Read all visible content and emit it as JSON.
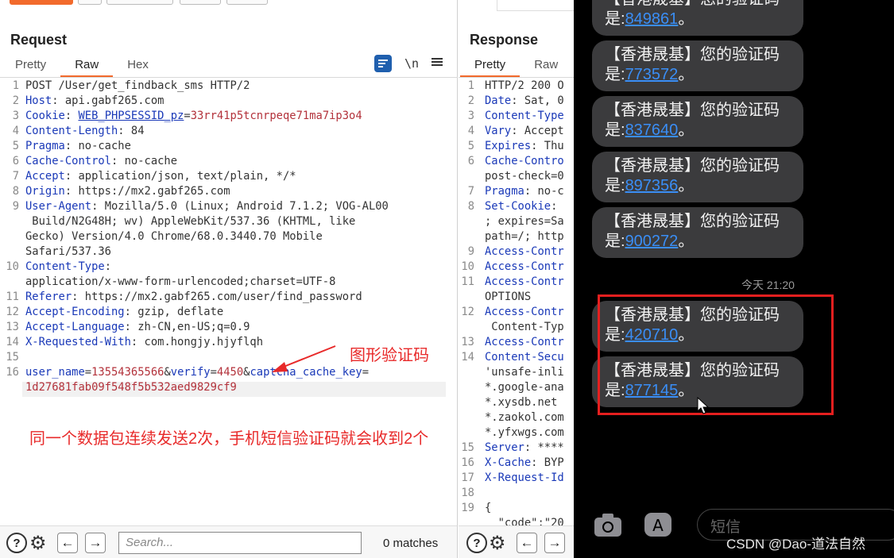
{
  "request": {
    "title": "Request",
    "tabs": [
      "Pretty",
      "Raw",
      "Hex"
    ],
    "active_tab": "Raw",
    "tool_newline": "\\n",
    "lines": [
      {
        "n": "1",
        "parts": [
          [
            "v",
            "POST /User/get_findback_sms HTTP/2"
          ]
        ]
      },
      {
        "n": "2",
        "parts": [
          [
            "k",
            "Host"
          ],
          [
            "v",
            ": api.gabf265.com"
          ]
        ]
      },
      {
        "n": "3",
        "parts": [
          [
            "k",
            "Cookie"
          ],
          [
            "v",
            ": "
          ],
          [
            "u",
            "WEB_PHPSESSID_pz"
          ],
          [
            "v",
            "="
          ],
          [
            "rv",
            "33rr41p5tcnrpeqe71ma7ip3o4"
          ]
        ]
      },
      {
        "n": "4",
        "parts": [
          [
            "k",
            "Content-Length"
          ],
          [
            "v",
            ": 84"
          ]
        ]
      },
      {
        "n": "5",
        "parts": [
          [
            "k",
            "Pragma"
          ],
          [
            "v",
            ": no-cache"
          ]
        ]
      },
      {
        "n": "6",
        "parts": [
          [
            "k",
            "Cache-Control"
          ],
          [
            "v",
            ": no-cache"
          ]
        ]
      },
      {
        "n": "7",
        "parts": [
          [
            "k",
            "Accept"
          ],
          [
            "v",
            ": application/json, text/plain, */*"
          ]
        ]
      },
      {
        "n": "8",
        "parts": [
          [
            "k",
            "Origin"
          ],
          [
            "v",
            ": https://mx2.gabf265.com"
          ]
        ]
      },
      {
        "n": "9",
        "parts": [
          [
            "k",
            "User-Agent"
          ],
          [
            "v",
            ": Mozilla/5.0 (Linux; Android 7.1.2; VOG-AL00"
          ]
        ]
      },
      {
        "n": "",
        "parts": [
          [
            "v",
            " Build/N2G48H; wv) AppleWebKit/537.36 (KHTML, like"
          ]
        ]
      },
      {
        "n": "",
        "parts": [
          [
            "v",
            "Gecko) Version/4.0 Chrome/68.0.3440.70 Mobile"
          ]
        ]
      },
      {
        "n": "",
        "parts": [
          [
            "v",
            "Safari/537.36"
          ]
        ]
      },
      {
        "n": "10",
        "parts": [
          [
            "k",
            "Content-Type"
          ],
          [
            "v",
            ":"
          ]
        ]
      },
      {
        "n": "",
        "parts": [
          [
            "v",
            "application/x-www-form-urlencoded;charset=UTF-8"
          ]
        ]
      },
      {
        "n": "11",
        "parts": [
          [
            "k",
            "Referer"
          ],
          [
            "v",
            ": https://mx2.gabf265.com/user/find_password"
          ]
        ]
      },
      {
        "n": "12",
        "parts": [
          [
            "k",
            "Accept-Encoding"
          ],
          [
            "v",
            ": gzip, deflate"
          ]
        ]
      },
      {
        "n": "13",
        "parts": [
          [
            "k",
            "Accept-Language"
          ],
          [
            "v",
            ": zh-CN,en-US;q=0.9"
          ]
        ]
      },
      {
        "n": "14",
        "parts": [
          [
            "k",
            "X-Requested-With"
          ],
          [
            "v",
            ": com.hongjy.hjyflqh"
          ]
        ]
      },
      {
        "n": "15",
        "parts": [
          [
            "v",
            ""
          ]
        ]
      },
      {
        "n": "16",
        "parts": [
          [
            "k",
            "user_name"
          ],
          [
            "v",
            "="
          ],
          [
            "rv",
            "13554365566"
          ],
          [
            "v",
            "&"
          ],
          [
            "k",
            "verify"
          ],
          [
            "v",
            "="
          ],
          [
            "rv",
            "4450"
          ],
          [
            "v",
            "&"
          ],
          [
            "k",
            "captcha_cache_key"
          ],
          [
            "v",
            "="
          ]
        ]
      },
      {
        "n": "",
        "parts": [
          [
            "rv",
            "1d27681fab09f548f5b532aed9829cf9"
          ]
        ]
      }
    ],
    "annotation_captcha": "图形验证码",
    "annotation_note": "同一个数据包连续发送2次，手机短信验证码就会收到2个",
    "search_placeholder": "Search...",
    "matches": "0 matches"
  },
  "response": {
    "title": "Response",
    "tabs": [
      "Pretty",
      "Raw"
    ],
    "active_tab": "Pretty",
    "lines": [
      {
        "n": "1",
        "parts": [
          [
            "v",
            "HTTP/2 200 O"
          ]
        ]
      },
      {
        "n": "2",
        "parts": [
          [
            "k",
            "Date"
          ],
          [
            "v",
            ": Sat, 0"
          ]
        ]
      },
      {
        "n": "3",
        "parts": [
          [
            "k",
            "Content-Type"
          ]
        ]
      },
      {
        "n": "4",
        "parts": [
          [
            "k",
            "Vary"
          ],
          [
            "v",
            ": Accept"
          ]
        ]
      },
      {
        "n": "5",
        "parts": [
          [
            "k",
            "Expires"
          ],
          [
            "v",
            ": Thu"
          ]
        ]
      },
      {
        "n": "6",
        "parts": [
          [
            "k",
            "Cache-Contro"
          ]
        ]
      },
      {
        "n": "",
        "parts": [
          [
            "v",
            "post-check=0"
          ]
        ]
      },
      {
        "n": "7",
        "parts": [
          [
            "k",
            "Pragma"
          ],
          [
            "v",
            ": no-c"
          ]
        ]
      },
      {
        "n": "8",
        "parts": [
          [
            "k",
            "Set-Cookie"
          ],
          [
            "v",
            ":"
          ]
        ]
      },
      {
        "n": "",
        "parts": [
          [
            "v",
            "; expires=Sa"
          ]
        ]
      },
      {
        "n": "",
        "parts": [
          [
            "v",
            "path=/; http"
          ]
        ]
      },
      {
        "n": "9",
        "parts": [
          [
            "k",
            "Access-Contr"
          ]
        ]
      },
      {
        "n": "10",
        "parts": [
          [
            "k",
            "Access-Contr"
          ]
        ]
      },
      {
        "n": "11",
        "parts": [
          [
            "k",
            "Access-Contr"
          ]
        ]
      },
      {
        "n": "",
        "parts": [
          [
            "v",
            "OPTIONS"
          ]
        ]
      },
      {
        "n": "12",
        "parts": [
          [
            "k",
            "Access-Contr"
          ]
        ]
      },
      {
        "n": "",
        "parts": [
          [
            "v",
            " Content-Typ"
          ]
        ]
      },
      {
        "n": "13",
        "parts": [
          [
            "k",
            "Access-Contr"
          ]
        ]
      },
      {
        "n": "14",
        "parts": [
          [
            "k",
            "Content-Secu"
          ]
        ]
      },
      {
        "n": "",
        "parts": [
          [
            "v",
            "'unsafe-inli"
          ]
        ]
      },
      {
        "n": "",
        "parts": [
          [
            "v",
            "*.google-ana"
          ]
        ]
      },
      {
        "n": "",
        "parts": [
          [
            "v",
            "*.xysdb.net"
          ]
        ]
      },
      {
        "n": "",
        "parts": [
          [
            "v",
            "*.zaokol.com"
          ]
        ]
      },
      {
        "n": "",
        "parts": [
          [
            "v",
            "*.yfxwgs.com"
          ]
        ]
      },
      {
        "n": "15",
        "parts": [
          [
            "k",
            "Server"
          ],
          [
            "v",
            ": ****"
          ]
        ]
      },
      {
        "n": "16",
        "parts": [
          [
            "k",
            "X-Cache"
          ],
          [
            "v",
            ": BYP"
          ]
        ]
      },
      {
        "n": "17",
        "parts": [
          [
            "k",
            "X-Request-Id"
          ]
        ]
      },
      {
        "n": "18",
        "parts": [
          [
            "v",
            ""
          ]
        ]
      },
      {
        "n": "19",
        "parts": [
          [
            "v",
            "{"
          ]
        ]
      },
      {
        "n": "",
        "parts": [
          [
            "v",
            "  \"code\":\"20"
          ]
        ]
      }
    ]
  },
  "phone": {
    "sms_prefix": "【香港晟基】您的验证码",
    "sms_mid": "是:",
    "sms_suffix": "。",
    "messages": [
      {
        "code": "849861"
      },
      {
        "code": "773572"
      },
      {
        "code": "837640"
      },
      {
        "code": "897356"
      },
      {
        "code": "900272"
      },
      {
        "code": "420710"
      },
      {
        "code": "877145"
      }
    ],
    "time_label": "今天 21:20",
    "input_placeholder": "短信",
    "watermark": "CSDN @Dao-道法自然",
    "link_color": "#3a8ef6",
    "highlight_color": "#e51f1f"
  }
}
